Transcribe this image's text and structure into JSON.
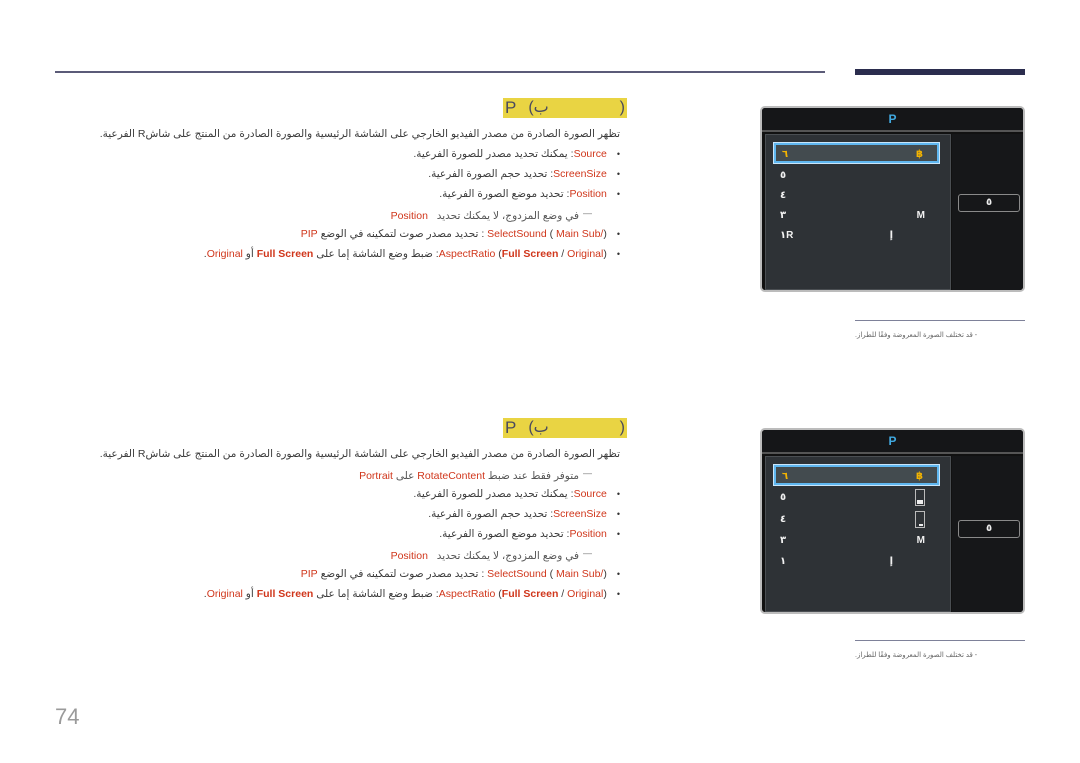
{
  "page": {
    "number": "74"
  },
  "sections": [
    {
      "heading": {
        "letter": "P",
        "open": "(ب",
        "close": ")"
      },
      "intro": "تظهر الصورة الصادرة من مصدر الفيديو الخارجي على الشاشة الرئيسية والصورة الصادرة من المنتج على شاشR الفرعية.",
      "portrait_note": null,
      "items": {
        "source": {
          "term": "Source",
          "desc": ": يمكنك تحديد مصدر للصورة الفرعية."
        },
        "screensize": {
          "term": "ScreenSize",
          "desc": ": تحديد حجم الصورة الفرعية."
        },
        "position": {
          "term": "Position",
          "desc": ": تحديد موضع الصورة الفرعية."
        },
        "position_note": {
          "text": "في وضع المزدوج، لا يمكنك تحديد",
          "term": "Position"
        },
        "selectsound": {
          "term": "SelectSound",
          "opt_open": "(",
          "opt1": "Sub/",
          "opt2": "Main",
          "opt_close": ")",
          "desc": ": تحديد مصدر صوت لتمكينه في الوضع",
          "pip": "PIP"
        },
        "aspectratio": {
          "term": "AspectRatio",
          "opt1": "Full Screen",
          "sep": " / ",
          "opt2": "Original",
          "desc": ": ضبط وضع الشاشة إما على",
          "opt_full": "Full Screen",
          "or": "أو",
          "opt_orig": "Original"
        }
      },
      "osd": {
        "title": "P",
        "menu": [
          {
            "label": "٦",
            "value": "฿",
            "selected": true
          },
          {
            "label": "٥",
            "value": ""
          },
          {
            "label": "٤",
            "value": ""
          },
          {
            "label": "٣",
            "value": "M"
          },
          {
            "label": "١R",
            "value": "إ"
          }
        ],
        "side_button": "٥"
      },
      "side_note": "- قد تختلف الصورة المعروضة وفقًا للطراز."
    },
    {
      "heading": {
        "letter": "P",
        "open": "(ب",
        "close": ")"
      },
      "intro": "تظهر الصورة الصادرة من مصدر الفيديو الخارجي على الشاشة الرئيسية والصورة الصادرة من المنتج على شاشR الفرعية.",
      "portrait_note": {
        "text": "متوفر فقط عند ضبط",
        "term": "RotateContent",
        "on": "على",
        "value": "Portrait"
      },
      "items": {
        "source": {
          "term": "Source",
          "desc": ": يمكنك تحديد مصدر للصورة الفرعية."
        },
        "screensize": {
          "term": "ScreenSize",
          "desc": ": تحديد حجم الصورة الفرعية."
        },
        "position": {
          "term": "Position",
          "desc": ": تحديد موضع الصورة الفرعية."
        },
        "position_note": {
          "text": "في وضع المزدوج، لا يمكنك تحديد",
          "term": "Position"
        },
        "selectsound": {
          "term": "SelectSound",
          "opt_open": "(",
          "opt1": "Sub/",
          "opt2": "Main",
          "opt_close": ")",
          "desc": ": تحديد مصدر صوت لتمكينه في الوضع",
          "pip": "PIP"
        },
        "aspectratio": {
          "term": "AspectRatio",
          "opt1": "Full Screen",
          "sep": " / ",
          "opt2": "Original",
          "desc": ": ضبط وضع الشاشة إما على",
          "opt_full": "Full Screen",
          "or": "أو",
          "opt_orig": "Original"
        }
      },
      "osd": {
        "title": "P",
        "menu": [
          {
            "label": "٦",
            "value": "฿",
            "selected": true
          },
          {
            "label": "٥",
            "value": "",
            "size_indicator": "large"
          },
          {
            "label": "٤",
            "value": "",
            "size_indicator": "small"
          },
          {
            "label": "٣",
            "value": "M"
          },
          {
            "label": "١",
            "value": "إ"
          }
        ],
        "side_button": "٥"
      },
      "side_note": "- قد تختلف الصورة المعروضة وفقًا للطراز."
    }
  ]
}
